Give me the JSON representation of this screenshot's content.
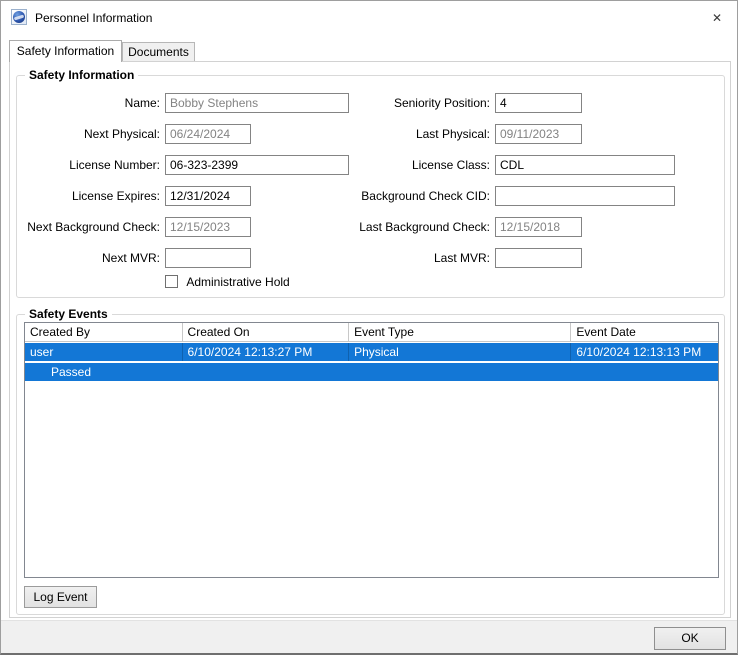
{
  "window": {
    "title": "Personnel Information",
    "close_glyph": "✕"
  },
  "tabs": [
    {
      "label": "Safety Information",
      "active": true
    },
    {
      "label": "Documents",
      "active": false
    }
  ],
  "safety_info": {
    "legend": "Safety Information",
    "fields_left": [
      {
        "label": "Name:",
        "value": "Bobby Stephens",
        "disabled": true
      },
      {
        "label": "Next Physical:",
        "value": "06/24/2024",
        "disabled": true
      },
      {
        "label": "License Number:",
        "value": "06-323-2399",
        "disabled": false
      },
      {
        "label": "License Expires:",
        "value": "12/31/2024",
        "disabled": false
      },
      {
        "label": "Next Background Check:",
        "value": "12/15/2023",
        "disabled": true
      },
      {
        "label": "Next MVR:",
        "value": "",
        "disabled": false
      }
    ],
    "fields_right": [
      {
        "label": "Seniority Position:",
        "value": "4",
        "disabled": false
      },
      {
        "label": "Last Physical:",
        "value": "09/11/2023",
        "disabled": true
      },
      {
        "label": "License Class:",
        "value": "CDL",
        "disabled": false
      },
      {
        "label": "Background Check CID:",
        "value": "",
        "disabled": false
      },
      {
        "label": "Last Background Check:",
        "value": "12/15/2018",
        "disabled": true
      },
      {
        "label": "Last MVR:",
        "value": "",
        "disabled": false
      }
    ],
    "admin_hold": {
      "label": "Administrative Hold",
      "checked": false
    }
  },
  "safety_events": {
    "legend": "Safety Events",
    "columns": [
      "Created By",
      "Created On",
      "Event Type",
      "Event Date"
    ],
    "rows": [
      {
        "created_by": "user",
        "created_on": "6/10/2024 12:13:27 PM",
        "event_type": "Physical",
        "event_date": "6/10/2024 12:13:13 PM",
        "result": "Passed",
        "selected": true
      }
    ],
    "log_event_label": "Log Event"
  },
  "footer": {
    "ok_label": "OK"
  },
  "colors": {
    "selection_blue": "#1377d6",
    "disabled_text": "#838383",
    "footer_bg": "#f0f0f0",
    "field_border": "#848484"
  }
}
